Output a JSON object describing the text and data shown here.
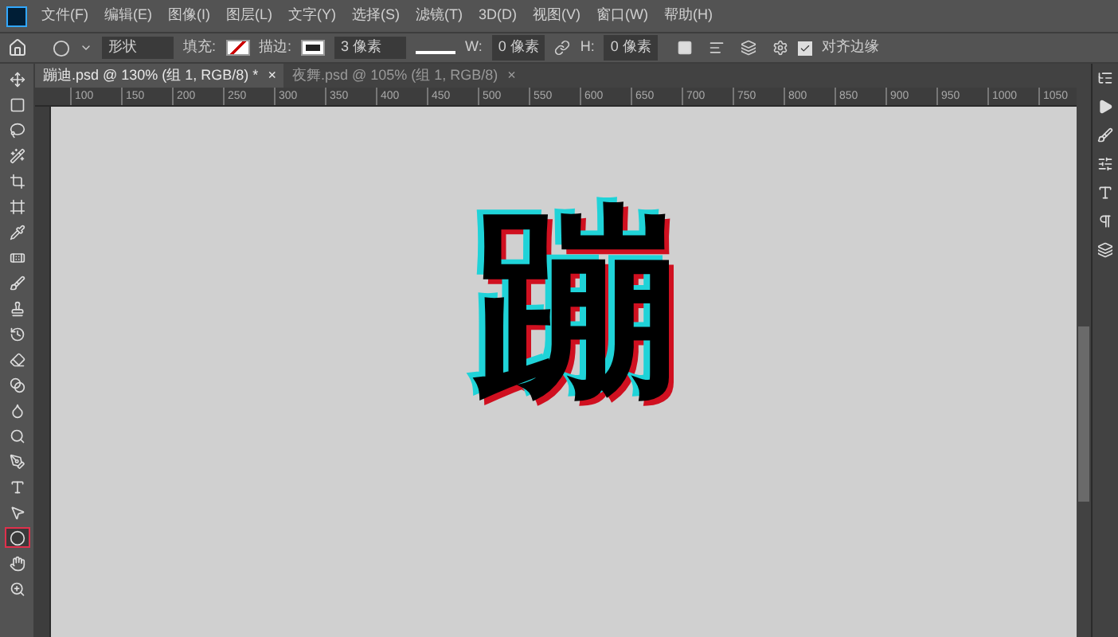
{
  "menu": [
    "文件(F)",
    "编辑(E)",
    "图像(I)",
    "图层(L)",
    "文字(Y)",
    "选择(S)",
    "滤镜(T)",
    "3D(D)",
    "视图(V)",
    "窗口(W)",
    "帮助(H)"
  ],
  "options_bar": {
    "shape_mode": "形状",
    "fill_label": "填充:",
    "stroke_label": "描边:",
    "stroke_width": "3 像素",
    "w_label": "W:",
    "w_value": "0 像素",
    "h_label": "H:",
    "h_value": "0 像素",
    "align_edges": {
      "label": "对齐边缘",
      "checked": true
    }
  },
  "tabs": [
    {
      "label": "蹦迪.psd @ 130% (组 1, RGB/8) *",
      "close": "×",
      "selected": true
    },
    {
      "label": "夜舞.psd @ 105% (组 1, RGB/8)",
      "close": "×",
      "selected": false
    }
  ],
  "ruler": {
    "ticks": [
      "100",
      "150",
      "200",
      "250",
      "300",
      "350",
      "400",
      "450",
      "500",
      "550",
      "600",
      "650",
      "700",
      "750",
      "800",
      "850",
      "900",
      "950",
      "1000",
      "1050"
    ]
  },
  "tools": [
    {
      "kind": "move",
      "selected": false
    },
    {
      "kind": "marquee",
      "selected": false
    },
    {
      "kind": "lasso",
      "selected": false
    },
    {
      "kind": "wand",
      "selected": false
    },
    {
      "kind": "crop",
      "selected": false
    },
    {
      "kind": "frame",
      "selected": false
    },
    {
      "kind": "eyedropper",
      "selected": false
    },
    {
      "kind": "healing",
      "selected": false
    },
    {
      "kind": "brush",
      "selected": false
    },
    {
      "kind": "stamp",
      "selected": false
    },
    {
      "kind": "history",
      "selected": false
    },
    {
      "kind": "eraser",
      "selected": false
    },
    {
      "kind": "gradient",
      "selected": false
    },
    {
      "kind": "blur",
      "selected": false
    },
    {
      "kind": "dodge",
      "selected": false
    },
    {
      "kind": "pen",
      "selected": false
    },
    {
      "kind": "type",
      "selected": false
    },
    {
      "kind": "select",
      "selected": false
    },
    {
      "kind": "ellipse",
      "selected": true
    },
    {
      "kind": "hand",
      "selected": false
    },
    {
      "kind": "zoom",
      "selected": false
    }
  ],
  "canvas_text": [
    "蹦"
  ]
}
